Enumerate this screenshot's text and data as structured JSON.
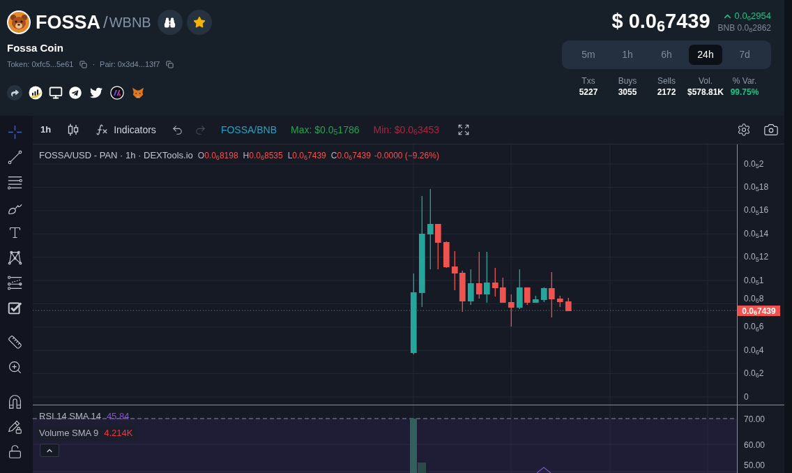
{
  "header": {
    "symbol": "FOSSA",
    "separator": "/",
    "quote": "WBNB",
    "name": "Fossa Coin",
    "token_address": "Token: 0xfc5...5e61",
    "address_separator": "·",
    "pair_address": "Pair: 0x3d4...13f7"
  },
  "price": {
    "value": "$ 0.0$_{6}$7439",
    "change": "0.0$_{6}$2954",
    "rising": true,
    "bnb": "BNB 0.0$_{8}$2862"
  },
  "timeframes": [
    {
      "label": "5m",
      "selected": false
    },
    {
      "label": "1h",
      "selected": false
    },
    {
      "label": "6h",
      "selected": false
    },
    {
      "label": "24h",
      "selected": true
    },
    {
      "label": "7d",
      "selected": false
    }
  ],
  "stats": [
    {
      "label": "Txs",
      "value": "5227",
      "color": "#ffffff"
    },
    {
      "label": "Buys",
      "value": "3055",
      "color": "#ffffff"
    },
    {
      "label": "Sells",
      "value": "2172",
      "color": "#ffffff"
    },
    {
      "label": "Vol.",
      "value": "$578.81K",
      "color": "#ffffff"
    },
    {
      "label": "% Var.",
      "value": "99.75%",
      "color": "#16c784"
    }
  ],
  "tool_groups": [
    [
      {
        "kind": "crosshair",
        "selected": true
      },
      {
        "kind": "trend-line",
        "selected": false
      },
      {
        "kind": "horizontal-lines",
        "selected": false
      },
      {
        "kind": "brush",
        "selected": false
      },
      {
        "kind": "text",
        "selected": false
      },
      {
        "kind": "pattern",
        "selected": false
      },
      {
        "kind": "fib",
        "selected": false
      },
      {
        "kind": "checklist",
        "selected": false
      }
    ],
    [
      {
        "kind": "ruler",
        "selected": false
      },
      {
        "kind": "zoom",
        "selected": false
      }
    ],
    [
      {
        "kind": "magnet",
        "selected": false
      },
      {
        "kind": "pencil-lock",
        "selected": false
      },
      {
        "kind": "lock",
        "selected": false
      }
    ]
  ],
  "toolbar": {
    "interval": "1h",
    "indicators": "Indicators",
    "history": [
      {
        "kind": "undo",
        "disabled": false
      },
      {
        "kind": "redo",
        "disabled": true
      }
    ],
    "pair": "FOSSA/BNB",
    "extremes": [
      {
        "kind": "max",
        "text": "Max: $0.0$_{5}$1786"
      },
      {
        "kind": "min",
        "text": "Min: $0.0$_{6}$3453"
      }
    ]
  },
  "chart": {
    "legend": {
      "title": "FOSSA/USD - PAN · 1h · DEXTools.io",
      "rising": false,
      "ohlc": [
        {
          "key": "O",
          "value": "0.0$_{6}$8198"
        },
        {
          "key": "H",
          "value": "0.0$_{6}$8535"
        },
        {
          "key": "L",
          "value": "0.0$_{6}$7439"
        },
        {
          "key": "C",
          "value": "0.0$_{6}$7439"
        }
      ],
      "change": "-0.0000 (−9.26%)"
    },
    "price_ticks": [
      "0.0$_{5}$2",
      "0.0$_{5}$18",
      "0.0$_{5}$16",
      "0.0$_{5}$14",
      "0.0$_{5}$12",
      "0.0$_{5}$1",
      "0.0$_{6}$8",
      "0.0$_{6}$6",
      "0.0$_{6}$4",
      "0.0$_{6}$2",
      "0"
    ],
    "last_price": "0.0$_{6}$7439"
  },
  "indicators": {
    "rsi": {
      "label": "RSI 14 SMA 14",
      "value": "45.84"
    },
    "volume": {
      "label": "Volume SMA 9",
      "value": "4.214K"
    },
    "ticks": [
      "70.00",
      "60.00",
      "50.00"
    ]
  }
}
